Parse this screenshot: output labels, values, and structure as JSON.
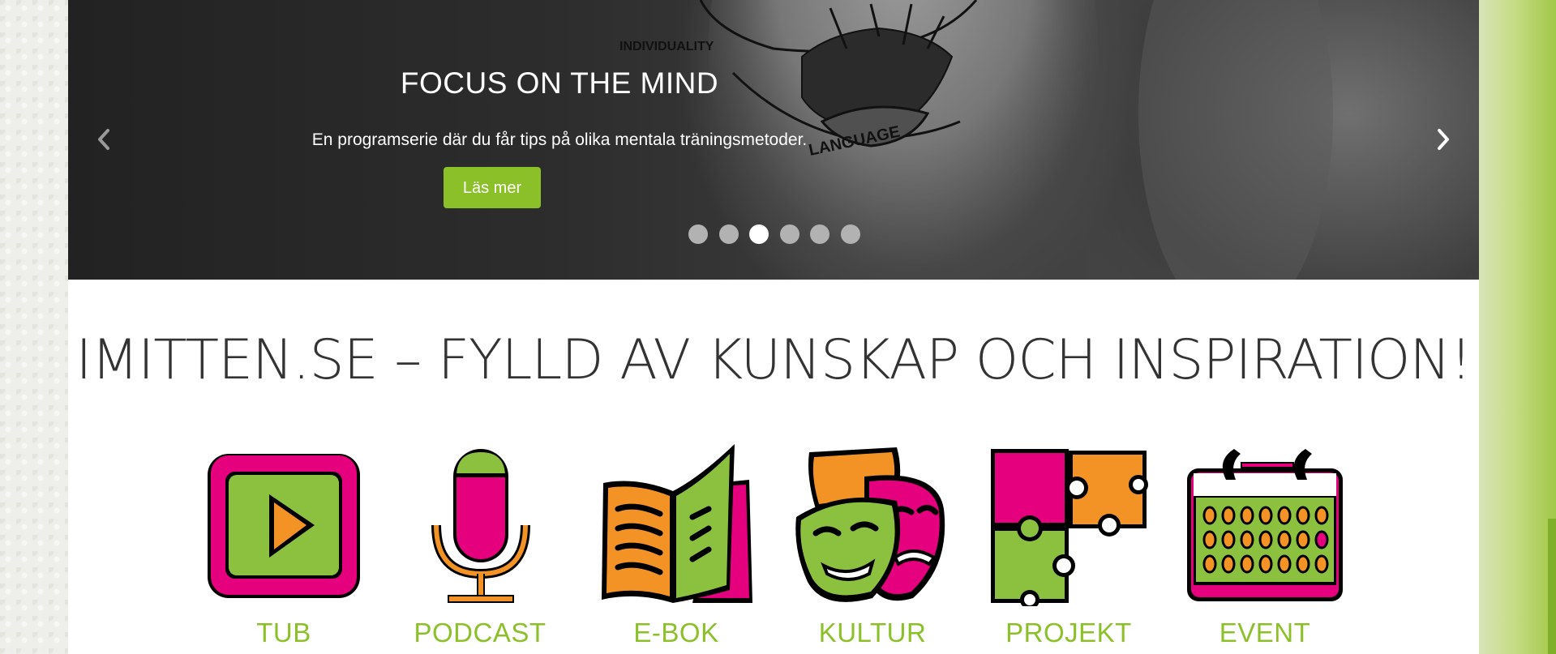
{
  "hero": {
    "title": "FOCUS ON THE MIND",
    "subtitle": "En programserie där du får tips på olika mentala träningsmetoder.",
    "button_label": "Läs mer",
    "image_labels": {
      "individuality": "INDIVIDUALITY",
      "language": "LANGUAGE"
    },
    "slide_count": 6,
    "active_slide": 3
  },
  "main": {
    "heading": "IMITTEN.SE – FYLLD AV KUNSKAP OCH INSPIRATION!"
  },
  "categories": [
    {
      "label": "TUB",
      "icon": "video-play-icon"
    },
    {
      "label": "PODCAST",
      "icon": "microphone-icon"
    },
    {
      "label": "E-BOK",
      "icon": "book-icon"
    },
    {
      "label": "KULTUR",
      "icon": "theater-masks-icon"
    },
    {
      "label": "PROJEKT",
      "icon": "puzzle-icon"
    },
    {
      "label": "EVENT",
      "icon": "calendar-icon"
    }
  ],
  "colors": {
    "accent_green": "#8cc029",
    "magenta": "#e5007e",
    "orange": "#f39325",
    "heading_text": "#333333"
  }
}
